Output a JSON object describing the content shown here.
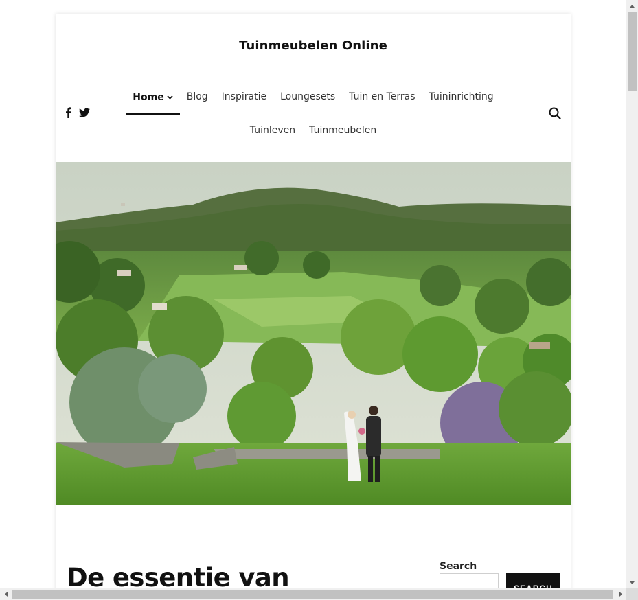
{
  "site": {
    "title": "Tuinmeubelen Online"
  },
  "nav": {
    "row1": [
      "Home",
      "Blog",
      "Inspiratie",
      "Loungesets",
      "Tuin en Terras",
      "Tuininrichting"
    ],
    "row2": [
      "Tuinleven",
      "Tuinmeubelen"
    ],
    "active": "Home"
  },
  "social": {
    "icons": [
      "facebook-icon",
      "twitter-icon"
    ]
  },
  "header": {
    "search_icon": "search-icon"
  },
  "hero": {
    "alt": "bride-and-groom-landscape"
  },
  "post": {
    "title": "De essentie van"
  },
  "sidebar": {
    "search": {
      "heading": "Search",
      "value": "",
      "placeholder": "",
      "button_label": "SEARCH"
    }
  },
  "colors": {
    "text": "#111111",
    "accent": "#111111",
    "nav_text": "#333333"
  }
}
